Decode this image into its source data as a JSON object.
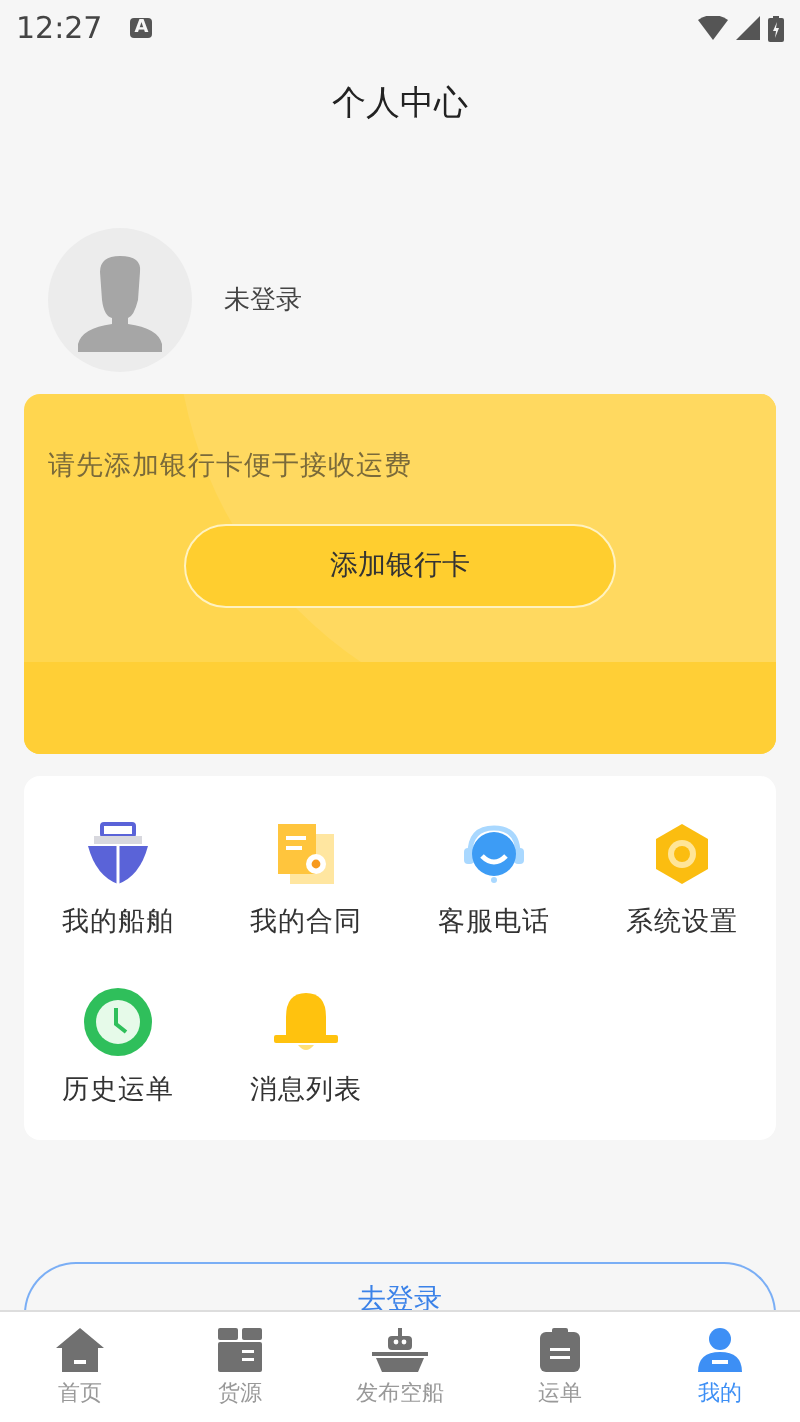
{
  "status_bar": {
    "time": "12:27",
    "indicator": "A"
  },
  "title": "个人中心",
  "profile": {
    "name": "未登录"
  },
  "bank_card": {
    "hint": "请先添加银行卡便于接收运费",
    "button": "添加银行卡"
  },
  "menu": [
    {
      "kind": "ship",
      "label": "我的船舶"
    },
    {
      "kind": "contract",
      "label": "我的合同"
    },
    {
      "kind": "service",
      "label": "客服电话"
    },
    {
      "kind": "settings",
      "label": "系统设置"
    },
    {
      "kind": "history",
      "label": "历史运单"
    },
    {
      "kind": "bell",
      "label": "消息列表"
    }
  ],
  "login_button": "去登录",
  "tabs": [
    {
      "kind": "home",
      "label": "首页",
      "selected": false
    },
    {
      "kind": "cargo",
      "label": "货源",
      "selected": false
    },
    {
      "kind": "boat",
      "label": "发布空船",
      "selected": false
    },
    {
      "kind": "order",
      "label": "运单",
      "selected": false
    },
    {
      "kind": "me",
      "label": "我的",
      "selected": true
    }
  ]
}
